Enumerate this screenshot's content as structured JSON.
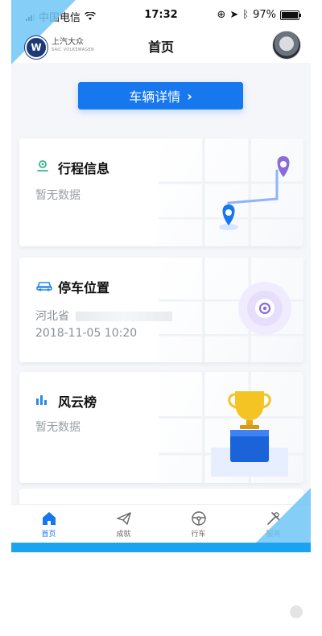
{
  "status_bar": {
    "carrier": "中国电信",
    "time": "17:32",
    "battery": "97%"
  },
  "header": {
    "brand_cn": "上汽大众",
    "brand_en": "SAIC VOLKSWAGEN",
    "title": "首页"
  },
  "vehicle_button": {
    "label": "车辆详情",
    "chevron": "›"
  },
  "cards": {
    "trip": {
      "title": "行程信息",
      "subtitle": "暂无数据",
      "icon": "route-icon"
    },
    "parking": {
      "title": "停车位置",
      "address": "河北省",
      "time": "2018-11-05 10:20",
      "icon": "car-icon"
    },
    "ranking": {
      "title": "风云榜",
      "subtitle": "暂无数据",
      "icon": "bar-chart-icon"
    }
  },
  "tabs": [
    {
      "label": "首页",
      "icon": "home-icon",
      "active": true
    },
    {
      "label": "成就",
      "icon": "paper-plane-icon",
      "active": false
    },
    {
      "label": "行车",
      "icon": "steering-wheel-icon",
      "active": false
    },
    {
      "label": "服务",
      "icon": "tools-icon",
      "active": false
    }
  ],
  "colors": {
    "accent": "#1677ee",
    "highlight": "#6fc6f6"
  }
}
